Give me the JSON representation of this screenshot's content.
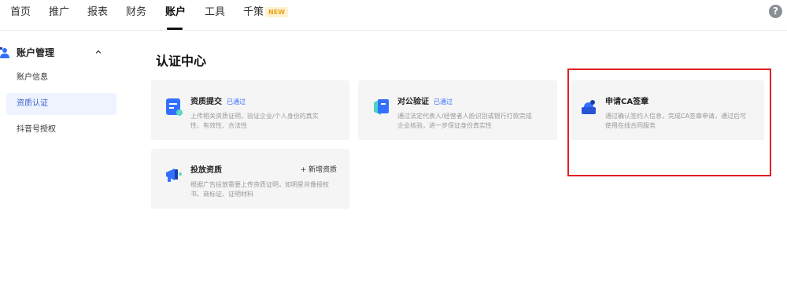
{
  "topnav": {
    "items": [
      {
        "label": "首页"
      },
      {
        "label": "推广"
      },
      {
        "label": "报表"
      },
      {
        "label": "财务"
      },
      {
        "label": "账户"
      },
      {
        "label": "工具"
      },
      {
        "label": "千策"
      }
    ],
    "active_index": 4,
    "new_badge": "NEW",
    "help": "?"
  },
  "sidebar": {
    "group_label": "账户管理",
    "items": [
      {
        "label": "账户信息"
      },
      {
        "label": "资质认证"
      },
      {
        "label": "抖音号授权"
      }
    ],
    "active_index": 1
  },
  "main": {
    "title": "认证中心",
    "cards": [
      {
        "title": "资质提交",
        "status": "已通过",
        "desc_line1": "上传相关资质证明，验证企业/个人身份的真实",
        "desc_line2": "性、有效性、合法性"
      },
      {
        "title": "对公验证",
        "status": "已通过",
        "desc_line1": "通过法定代表人/经营者人脸识别或银行打款完成",
        "desc_line2": "企业核验，进一步保证身份真实性"
      },
      {
        "title": "申请CA签章",
        "desc_line1": "通过确认签约人信息，完成CA签章申请，通过后可",
        "desc_line2": "使用在线合同服务"
      },
      {
        "title": "投放资质",
        "action": "+ 新增资质",
        "desc_line1": "根据广告投放需要上传资质证明，如明星肖像授权",
        "desc_line2": "书、商标证、证明材料"
      }
    ]
  },
  "colors": {
    "accent_blue": "#3370ff",
    "highlight_red": "#e02020",
    "card_bg": "#f5f5f5"
  }
}
